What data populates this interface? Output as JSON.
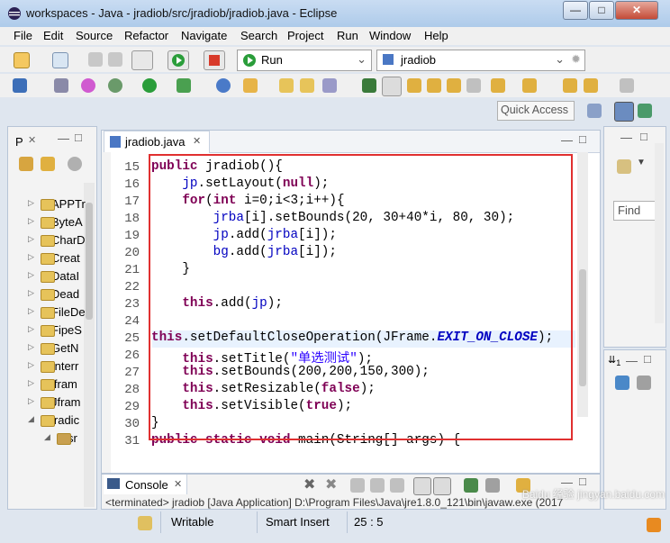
{
  "window": {
    "title": "workspaces - Java - jradiob/src/jradiob/jradiob.java - Eclipse",
    "min": "—",
    "max": "□",
    "close": "✕"
  },
  "menu": [
    "File",
    "Edit",
    "Source",
    "Refactor",
    "Navigate",
    "Search",
    "Project",
    "Run",
    "Window",
    "Help"
  ],
  "toolbar": {
    "run_config": "Run",
    "project_combo": "jradiob",
    "quick_access": "Quick Access"
  },
  "left_panel": {
    "tab": "P",
    "items": [
      "APPTr",
      "ByteA",
      "CharD",
      "Creat",
      "DataI",
      "Dead",
      "FileDe",
      "FipeS",
      "GetN",
      "Interr",
      "jfram",
      "Jfram",
      "jradic",
      "sr"
    ]
  },
  "right_panel": {
    "find_placeholder": "Find",
    "outline_tab": "1"
  },
  "editor": {
    "tab": "jradiob.java",
    "line_numbers": [
      "15",
      "16",
      "17",
      "18",
      "19",
      "20",
      "21",
      "22",
      "23",
      "24",
      "25",
      "26",
      "27",
      "28",
      "29",
      "30",
      "31"
    ]
  },
  "console": {
    "tab": "Console",
    "text": "<terminated> jradiob [Java Application] D:\\Program Files\\Java\\jre1.8.0_121\\bin\\javaw.exe (2017"
  },
  "statusbar": {
    "mode": "Writable",
    "insert": "Smart Insert",
    "position": "25 : 5"
  },
  "watermark": "Baidu 经验 jingyan.baidu.com",
  "colors": {
    "keyword": "#7f0055",
    "field": "#0000c0",
    "string": "#2a00ff",
    "highlight_box": "#e03030"
  }
}
